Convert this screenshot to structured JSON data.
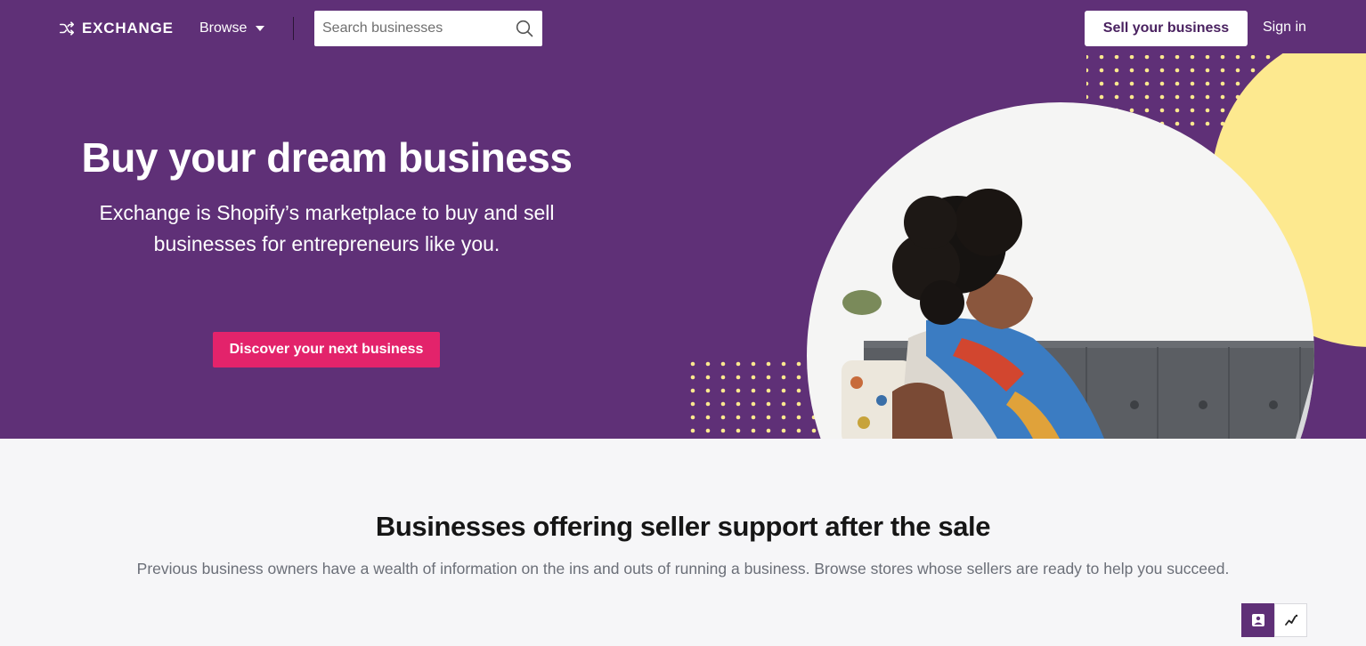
{
  "nav": {
    "logo_text": "EXCHANGE",
    "browse_label": "Browse",
    "search_placeholder": "Search businesses",
    "sell_label": "Sell your business",
    "signin_label": "Sign in"
  },
  "hero": {
    "title": "Buy your dream business",
    "subtitle_line1": "Exchange is Shopify’s marketplace to buy and sell",
    "subtitle_line2": "businesses for entrepreneurs like you.",
    "cta_label": "Discover your next business"
  },
  "section": {
    "title": "Businesses offering seller support after the sale",
    "subtitle": "Previous business owners have a wealth of information on the ins and outs of running a business. Browse stores whose sellers are ready to help you succeed."
  },
  "view_toggle": {
    "options": [
      {
        "icon": "image-icon",
        "active": true
      },
      {
        "icon": "trend-chart-icon",
        "active": false
      }
    ]
  },
  "colors": {
    "hero_bg": "#5f3077",
    "cta": "#e3236b",
    "accent_yellow": "#fde98f",
    "page_bg": "#f6f6f8"
  }
}
